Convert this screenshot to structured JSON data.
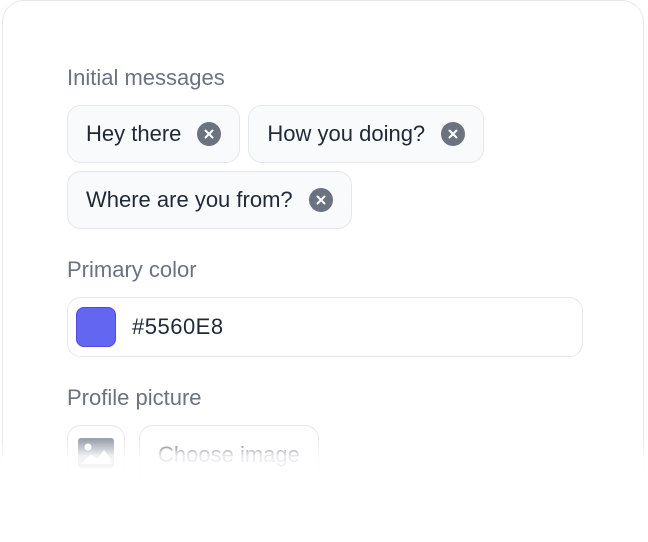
{
  "initial_messages": {
    "label": "Initial messages",
    "chips": [
      {
        "text": "Hey there",
        "remove_icon": "close-circle-icon"
      },
      {
        "text": "How you doing?",
        "remove_icon": "close-circle-icon"
      },
      {
        "text": "Where are you from?",
        "remove_icon": "close-circle-icon"
      }
    ]
  },
  "primary_color": {
    "label": "Primary color",
    "value": "#5560E8",
    "swatch_color": "#6366F1"
  },
  "profile_picture": {
    "label": "Profile picture",
    "thumbnail_icon": "image-icon",
    "button_label": "Choose image"
  },
  "colors": {
    "chip_remove_bg": "#6B7280",
    "label_text": "#6B7280",
    "border": "#E5E7EB"
  }
}
